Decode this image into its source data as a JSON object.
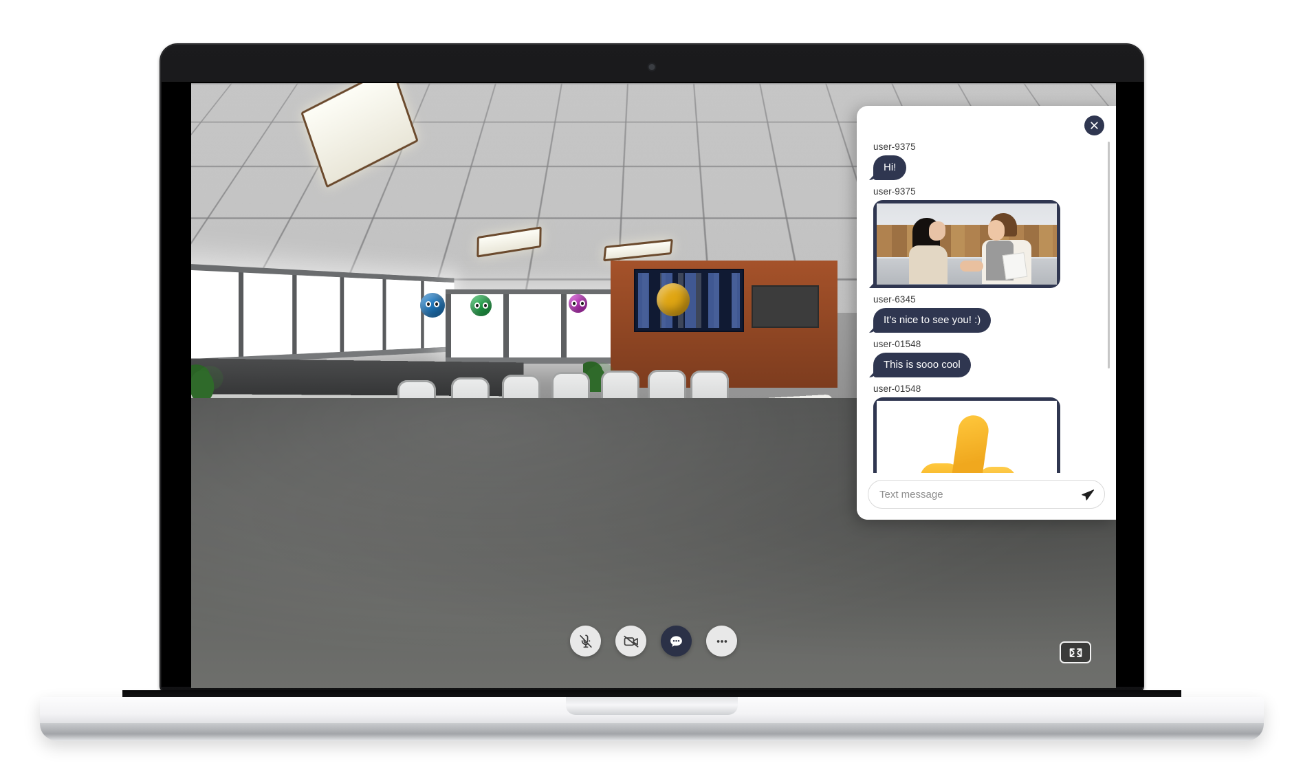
{
  "device": {
    "type": "laptop-mockup",
    "webcam": "webcam-dot"
  },
  "scene": {
    "label": "virtual 3d conference room",
    "avatars": [
      {
        "name": "",
        "color": "#1f7ac2"
      },
      {
        "name": "",
        "color": "#20a84a"
      },
      {
        "name": "",
        "color": "#c42ec4"
      },
      {
        "name": "",
        "color": "#e0a613"
      }
    ]
  },
  "controls": {
    "microphone": {
      "label": "Microphone",
      "state": "muted",
      "icon": "microphone-muted-icon"
    },
    "camera": {
      "label": "Camera",
      "state": "off",
      "icon": "camera-off-icon"
    },
    "chat": {
      "label": "Chat",
      "state": "active",
      "icon": "chat-bubble-icon"
    },
    "more": {
      "label": "More options",
      "state": "default",
      "icon": "more-horizontal-icon"
    },
    "fullscreen": {
      "label": "Fullscreen",
      "icon": "expand-arrows-icon"
    }
  },
  "chat": {
    "close_icon": "close-icon",
    "send_icon": "send-paper-plane-icon",
    "input": {
      "value": "",
      "placeholder": "Text message"
    },
    "messages": [
      {
        "author": "user-9375",
        "type": "text",
        "text": "Hi!"
      },
      {
        "author": "user-9375",
        "type": "image",
        "alt": "two people shaking hands in an office"
      },
      {
        "author": "user-6345",
        "type": "text",
        "text": "It's nice to see you! :)"
      },
      {
        "author": "user-01548",
        "type": "text",
        "text": "This is sooo cool"
      },
      {
        "author": "user-01548",
        "type": "image",
        "alt": "thumbs up emoji"
      }
    ]
  },
  "colors": {
    "bubble": "#2f3650",
    "panel": "#ffffff",
    "accent": "#2f3650"
  }
}
